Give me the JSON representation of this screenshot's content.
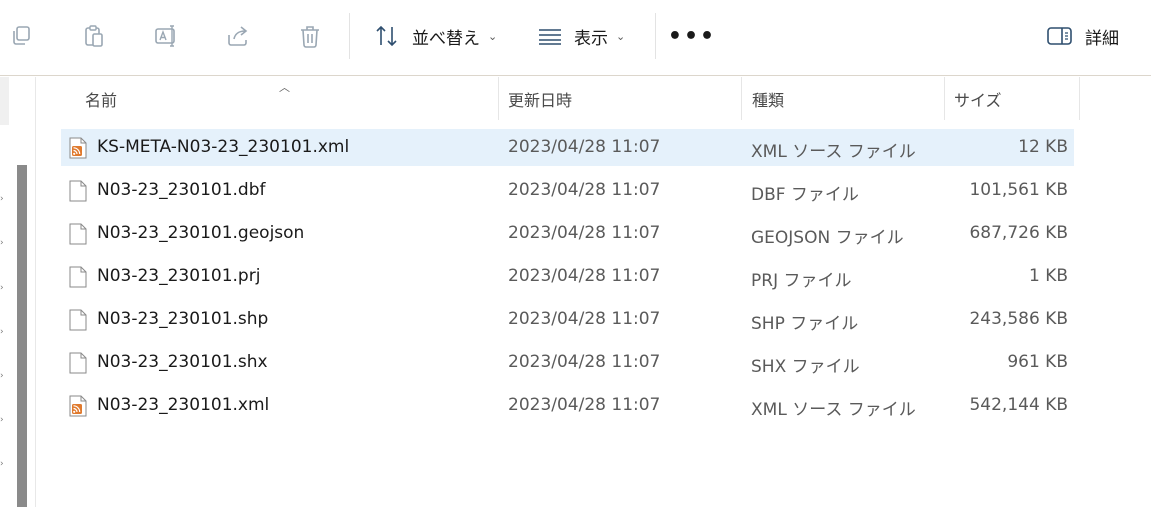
{
  "toolbar": {
    "icons": [
      "copy-icon",
      "paste-icon",
      "rename-icon",
      "share-icon",
      "delete-icon"
    ],
    "sort_label": "並べ替え",
    "view_label": "表示",
    "more_label": "•••",
    "details_label": "詳細"
  },
  "columns": {
    "name": "名前",
    "modified": "更新日時",
    "type": "種類",
    "size": "サイズ"
  },
  "files": [
    {
      "name": "KS-META-N03-23_230101.xml",
      "modified": "2023/04/28 11:07",
      "type": "XML ソース ファイル",
      "size": "12 KB",
      "icon": "xml-feed-icon",
      "selected": true
    },
    {
      "name": "N03-23_230101.dbf",
      "modified": "2023/04/28 11:07",
      "type": "DBF ファイル",
      "size": "101,561 KB",
      "icon": "file-icon",
      "selected": false
    },
    {
      "name": "N03-23_230101.geojson",
      "modified": "2023/04/28 11:07",
      "type": "GEOJSON ファイル",
      "size": "687,726 KB",
      "icon": "file-icon",
      "selected": false
    },
    {
      "name": "N03-23_230101.prj",
      "modified": "2023/04/28 11:07",
      "type": "PRJ ファイル",
      "size": "1 KB",
      "icon": "file-icon",
      "selected": false
    },
    {
      "name": "N03-23_230101.shp",
      "modified": "2023/04/28 11:07",
      "type": "SHP ファイル",
      "size": "243,586 KB",
      "icon": "file-icon",
      "selected": false
    },
    {
      "name": "N03-23_230101.shx",
      "modified": "2023/04/28 11:07",
      "type": "SHX ファイル",
      "size": "961 KB",
      "icon": "file-icon",
      "selected": false
    },
    {
      "name": "N03-23_230101.xml",
      "modified": "2023/04/28 11:07",
      "type": "XML ソース ファイル",
      "size": "542,144 KB",
      "icon": "xml-feed-icon",
      "selected": false
    }
  ],
  "colors": {
    "selected_row": "#e5f1fb",
    "toolbar_icon_disabled": "#9aa7b3",
    "toolbar_icon_active": "#2f4f6f",
    "xml_icon_orange": "#e07a2e"
  }
}
